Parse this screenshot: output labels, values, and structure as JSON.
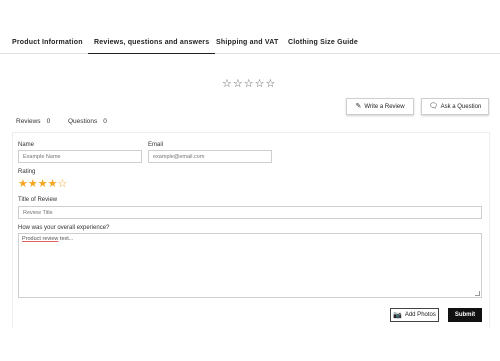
{
  "tabs": [
    {
      "label": "Product Information"
    },
    {
      "label": "Reviews, questions and answers"
    },
    {
      "label": "Shipping and VAT"
    },
    {
      "label": "Clothing Size Guide"
    }
  ],
  "summary": {
    "stars_filled": 0,
    "stars_total": 5
  },
  "actions": {
    "write_review": "Write a Review",
    "ask_question": "Ask a Question"
  },
  "subtabs": {
    "reviews": {
      "label": "Reviews",
      "count": "0"
    },
    "questions": {
      "label": "Questions",
      "count": "0"
    }
  },
  "form": {
    "name_label": "Name",
    "name_placeholder": "Example Name",
    "email_label": "Email",
    "email_placeholder": "example@email.com",
    "rating_label": "Rating",
    "rating_value": 4,
    "rating_max": 5,
    "title_label": "Title of Review",
    "title_placeholder": "Review Title",
    "experience_label": "How was your overall experience?",
    "review_placeholder_word1": "Product review",
    "review_placeholder_rest": " text..."
  },
  "footer": {
    "add_photos": "Add Photos",
    "submit": "Submit"
  },
  "colors": {
    "star": "#f5a623",
    "submit_bg": "#111111"
  }
}
